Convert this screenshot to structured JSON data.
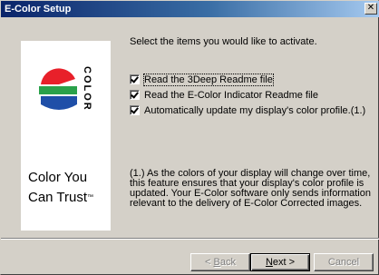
{
  "window": {
    "title": "E-Color Setup",
    "close_glyph": "✕"
  },
  "left_panel": {
    "logo_text": "COLOR",
    "tagline_line1": "Color You",
    "tagline_line2": "Can Trust",
    "trademark": "™",
    "colors": {
      "red": "#e8202a",
      "green": "#2aa14a",
      "blue": "#1f4fa8"
    }
  },
  "main": {
    "intro": "Select the items you would like to activate.",
    "options": [
      {
        "label": "Read the 3Deep Readme file",
        "checked": true
      },
      {
        "label": "Read the E-Color Indicator Readme file",
        "checked": true
      },
      {
        "label": "Automatically update my display's color profile.(1.)",
        "checked": true
      }
    ],
    "footnote": "(1.) As the colors of your display will change over time, this feature ensures that your display's color profile is updated.  Your E-Color software only sends information relevant to the delivery of E-Color Corrected images."
  },
  "buttons": {
    "back": {
      "pre": "< ",
      "accel": "B",
      "post": "ack"
    },
    "next": {
      "accel": "N",
      "post": "ext >"
    },
    "cancel": "Cancel"
  }
}
